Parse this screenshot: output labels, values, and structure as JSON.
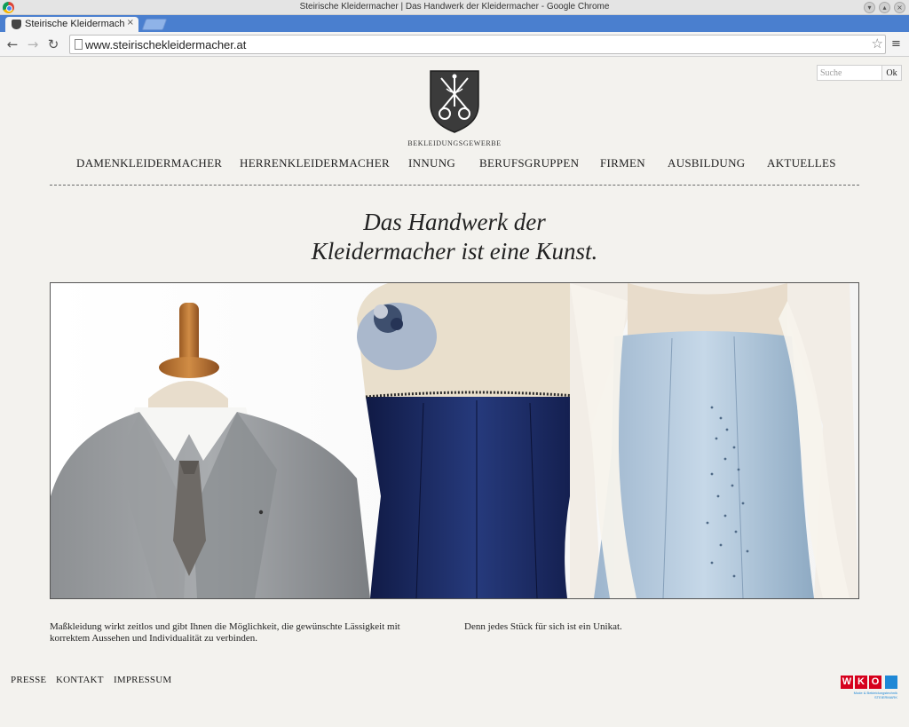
{
  "window": {
    "title": "Steirische Kleidermacher | Das Handwerk der Kleidermacher - Google Chrome"
  },
  "tab": {
    "title": "Steirische Kleidermacher",
    "close": "×"
  },
  "toolbar": {
    "back": "←",
    "forward": "→",
    "reload": "↻",
    "url": "www.steirischekleidermacher.at",
    "star": "☆",
    "menu": "≡"
  },
  "search": {
    "placeholder": "Suche",
    "button": "Ok"
  },
  "logo": {
    "caption": "BEKLEIDUNGSGEWERBE"
  },
  "nav": {
    "items": [
      "DAMENKLEIDERMACHER",
      "HERRENKLEIDERMACHER",
      "INNUNG",
      "BERUFSGRUPPEN",
      "FIRMEN",
      "AUSBILDUNG",
      "AKTUELLES"
    ]
  },
  "tagline": {
    "line1": "Das Handwerk der",
    "line2": "Kleidermacher ist eine Kunst."
  },
  "content": {
    "left": "Maßkleidung wirkt zeitlos und gibt Ihnen die Möglichkeit, die gewünschte Lässigkeit mit korrektem Aussehen und Individualität zu verbinden.",
    "right": "Denn jedes Stück für sich ist ein Unikat."
  },
  "footer": {
    "links": [
      "PRESSE",
      "KONTAKT",
      "IMPRESSUM"
    ],
    "wko_letters": [
      "W",
      "K",
      "O"
    ],
    "wko_sub": "Mode & Bekleidungstechnik STEIERMARK"
  },
  "colors": {
    "tabbar": "#4a7fcf",
    "wko_red": "#d6001c",
    "wko_blue": "#1e88d6",
    "dress_blue": "#1d2c63",
    "dress_light": "#b9cfe2"
  }
}
